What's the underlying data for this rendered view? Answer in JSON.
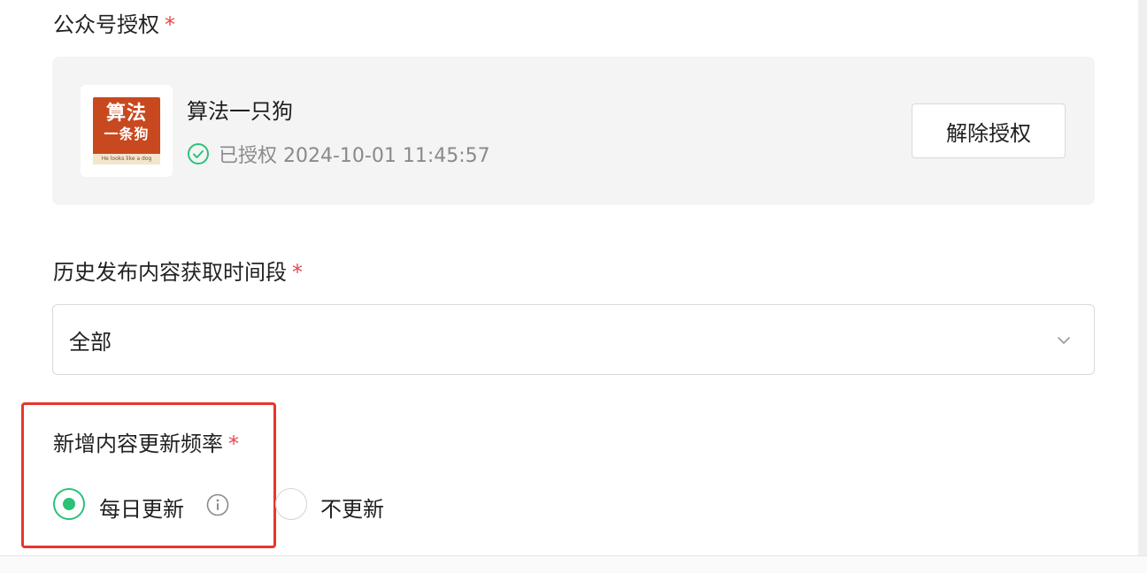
{
  "wechat_auth": {
    "label": "公众号授权",
    "required_mark": "*",
    "account": {
      "logo_text_line1": "算法",
      "logo_text_line2": "一条狗",
      "logo_tagline": "He looks like a dog",
      "name": "算法一只狗",
      "status_icon": "check-circle-icon",
      "status_text": "已授权 2024-10-01 11:45:57"
    },
    "revoke_button": "解除授权"
  },
  "history_range": {
    "label": "历史发布内容获取时间段",
    "required_mark": "*",
    "selected": "全部",
    "icon": "chevron-down-icon"
  },
  "update_frequency": {
    "label": "新增内容更新频率",
    "required_mark": "*",
    "options": [
      {
        "label": "每日更新",
        "checked": true,
        "icon": "info-icon"
      },
      {
        "label": "不更新",
        "checked": false
      }
    ]
  },
  "colors": {
    "accent_green": "#2bc276",
    "required_red": "#e5484d",
    "highlight_red": "#e8352c",
    "card_bg": "#f4f4f5",
    "logo_bg": "#c8491f"
  }
}
